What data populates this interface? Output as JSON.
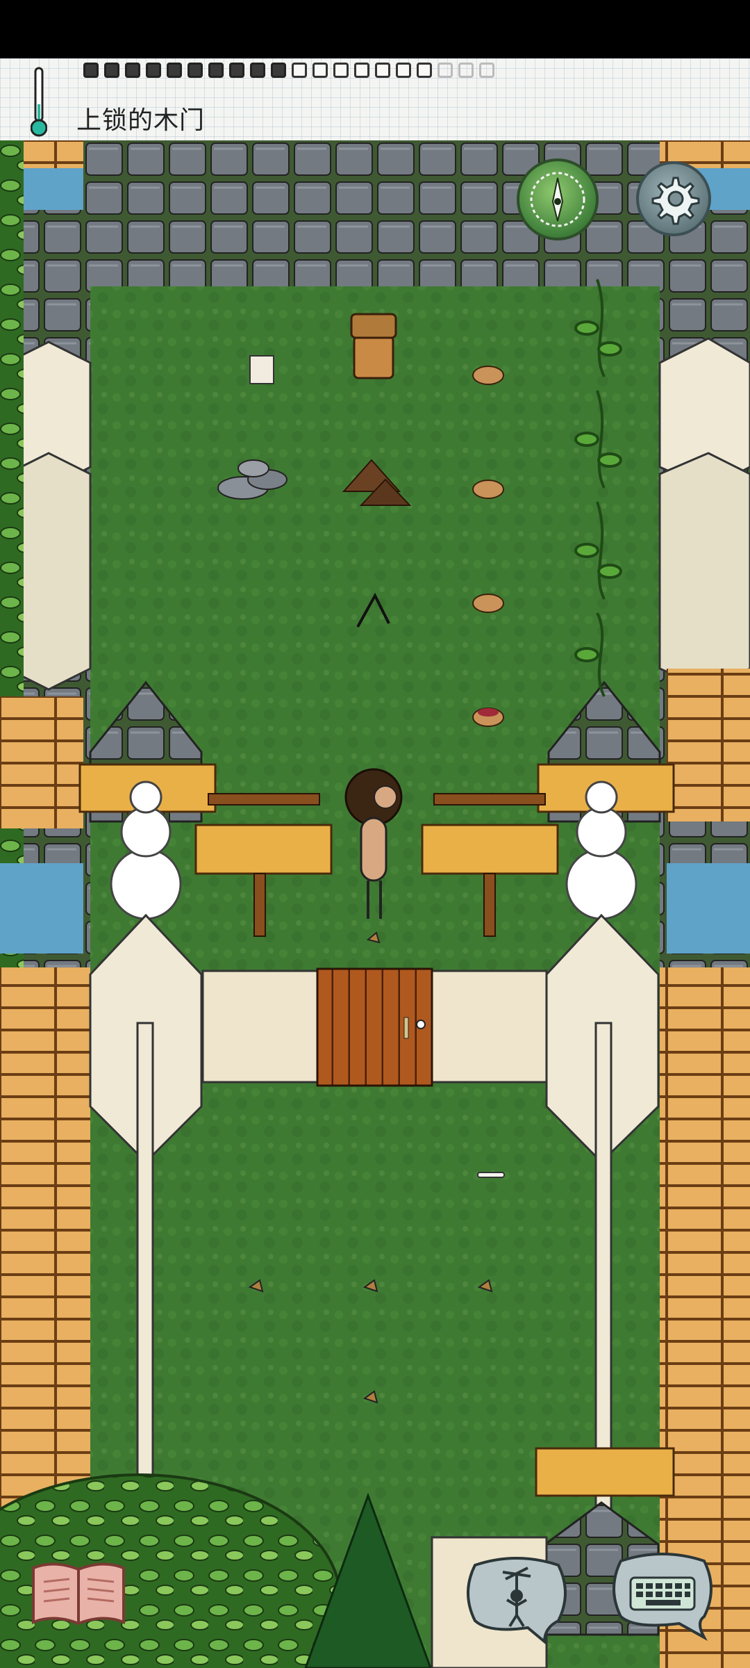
{
  "hud": {
    "location_name": "上锁的木门",
    "hunger_pips": {
      "filled": 10,
      "total": 20
    },
    "thermometer_icon": "thermometer-icon",
    "compass_icon": "compass-icon",
    "settings_icon": "gear-icon",
    "journal_icon": "open-book-icon",
    "emote_icon": "puppet-speech-bubble-icon",
    "keyboard_icon": "keyboard-speech-bubble-icon"
  },
  "colors": {
    "grass": "#3f7a33",
    "stone": "#6d737a",
    "water": "#5fa3c9",
    "wood_plank": "#e8a93a",
    "wood_door": "#a8521f",
    "limestone": "#efe9d6",
    "hedge": "#3f8f2c"
  },
  "scene": {
    "objects": [
      "woven-basket-on-crate",
      "paper-note",
      "stone-pile",
      "dirt-mound",
      "bent-stick",
      "empty-bowl",
      "empty-bowl",
      "empty-bowl",
      "berry-bowl",
      "climbing-bean-vines",
      "curly-haired-player",
      "left-snowman",
      "right-snowman",
      "locked-wooden-door",
      "wooden-sign-left",
      "wooden-sign-right",
      "bone",
      "twig-pieces"
    ]
  }
}
